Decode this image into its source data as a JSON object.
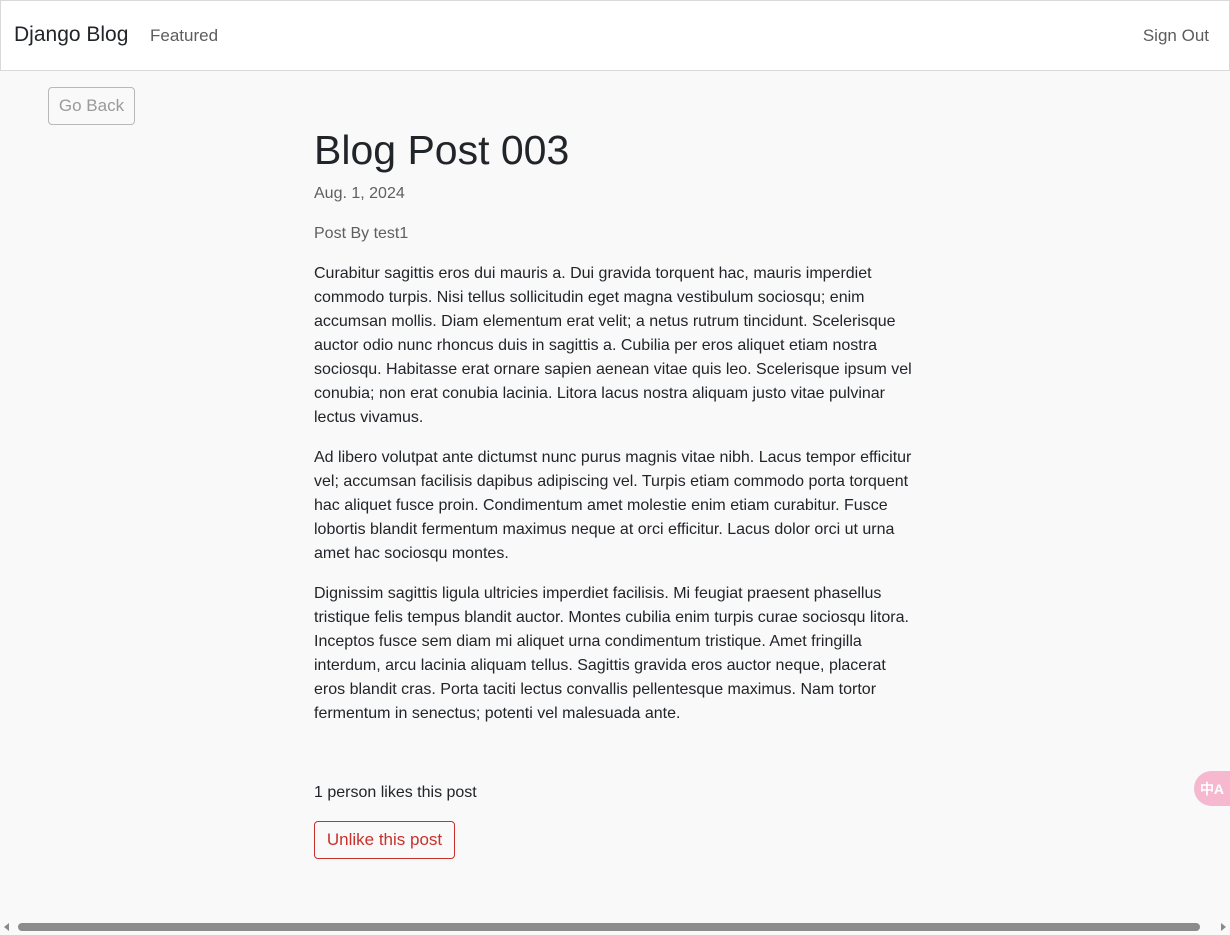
{
  "navbar": {
    "brand": "Django Blog",
    "links": [
      {
        "label": "Featured"
      }
    ],
    "right_link": "Sign Out"
  },
  "back_button": {
    "label": "Go Back"
  },
  "post": {
    "title": "Blog Post 003",
    "date": "Aug. 1, 2024",
    "author": "Post By test1",
    "paragraphs": [
      "Curabitur sagittis eros dui mauris a. Dui gravida torquent hac, mauris imperdiet commodo turpis. Nisi tellus sollicitudin eget magna vestibulum sociosqu; enim accumsan mollis. Diam elementum erat velit; a netus rutrum tincidunt. Scelerisque auctor odio nunc rhoncus duis in sagittis a. Cubilia per eros aliquet etiam nostra sociosqu. Habitasse erat ornare sapien aenean vitae quis leo. Scelerisque ipsum vel conubia; non erat conubia lacinia. Litora lacus nostra aliquam justo vitae pulvinar lectus vivamus.",
      "Ad libero volutpat ante dictumst nunc purus magnis vitae nibh. Lacus tempor efficitur vel; accumsan facilisis dapibus adipiscing vel. Turpis etiam commodo porta torquent hac aliquet fusce proin. Condimentum amet molestie enim etiam curabitur. Fusce lobortis blandit fermentum maximus neque at orci efficitur. Lacus dolor orci ut urna amet hac sociosqu montes.",
      "Dignissim sagittis ligula ultricies imperdiet facilisis. Mi feugiat praesent phasellus tristique felis tempus blandit auctor. Montes cubilia enim turpis curae sociosqu litora. Inceptos fusce sem diam mi aliquet urna condimentum tristique. Amet fringilla interdum, arcu lacinia aliquam tellus. Sagittis gravida eros auctor neque, placerat eros blandit cras. Porta taciti lectus convallis pellentesque maximus. Nam tortor fermentum in senectus; potenti vel malesuada ante."
    ],
    "likes_text": "1 person likes this post",
    "unlike_label": "Unlike this post"
  },
  "widgets": {
    "translate_glyph": "中A",
    "translate_icon": "translate-icon"
  },
  "colors": {
    "danger": "#c9302c",
    "translate_widget": "#f6b8cf"
  }
}
